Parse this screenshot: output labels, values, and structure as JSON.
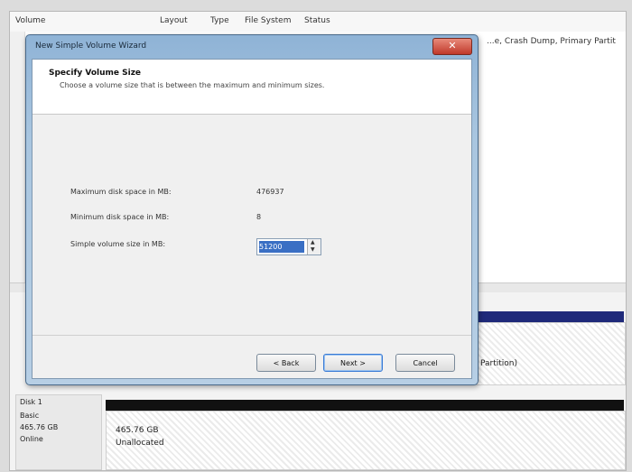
{
  "background": {
    "columns": [
      "Volume",
      "Layout",
      "Type",
      "File System",
      "Status"
    ],
    "row_status": "...e, Crash Dump, Primary Partit",
    "disk0_partition_text": "Partition)",
    "disk1": {
      "name": "Disk 1",
      "type": "Basic",
      "size": "465.76 GB",
      "state": "Online",
      "partition_size": "465.76 GB",
      "partition_state": "Unallocated"
    }
  },
  "dialog": {
    "title": "New Simple Volume Wizard",
    "close_glyph": "✕",
    "header": {
      "title": "Specify Volume Size",
      "subtitle": "Choose a volume size that is between the maximum and minimum sizes."
    },
    "fields": {
      "max_label": "Maximum disk space in MB:",
      "max_value": "476937",
      "min_label": "Minimum disk space in MB:",
      "min_value": "8",
      "size_label": "Simple volume size in MB:",
      "size_value": "51200"
    },
    "buttons": {
      "back": "< Back",
      "next": "Next >",
      "cancel": "Cancel"
    }
  },
  "colors": {
    "title_bar": "#a9c6e0",
    "close_button": "#c0392b",
    "selection": "#3a6fc4",
    "disk_bar_primary": "#1f2a7a",
    "disk_bar_unallocated": "#111111"
  }
}
